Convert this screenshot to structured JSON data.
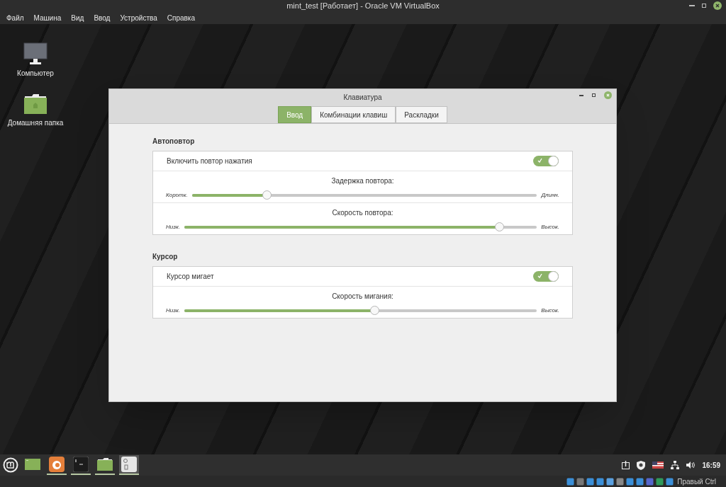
{
  "vbox": {
    "title": "mint_test [Работает] - Oracle VM VirtualBox",
    "menu": [
      "Файл",
      "Машина",
      "Вид",
      "Ввод",
      "Устройства",
      "Справка"
    ]
  },
  "desktop_icons": [
    {
      "kind": "computer",
      "label": "Компьютер"
    },
    {
      "kind": "folder",
      "label": "Домашняя папка"
    }
  ],
  "dialog": {
    "title": "Клавиатура",
    "tabs": [
      {
        "label": "Ввод",
        "selected": true
      },
      {
        "label": "Комбинации клавиш",
        "selected": false
      },
      {
        "label": "Раскладки",
        "selected": false
      }
    ],
    "sections": [
      {
        "heading": "Автоповтор",
        "rows": [
          {
            "kind": "switch",
            "label": "Включить повтор нажатия",
            "on": true
          },
          {
            "kind": "slider",
            "label": "Задержка повтора:",
            "min_label": "Коротк.",
            "max_label": "Длинн.",
            "level": 0.21
          },
          {
            "kind": "slider",
            "label": "Скорость повтора:",
            "min_label": "Низк.",
            "max_label": "Высок.",
            "level": 0.905
          }
        ]
      },
      {
        "heading": "Курсор",
        "rows": [
          {
            "kind": "switch",
            "label": "Курсор мигает",
            "on": true
          },
          {
            "kind": "slider",
            "label": "Скорость мигания:",
            "min_label": "Низк.",
            "max_label": "Высок.",
            "level": 0.54
          }
        ]
      }
    ]
  },
  "taskbar": {
    "apps": [
      {
        "kind": "files",
        "running": false,
        "selected": false
      },
      {
        "kind": "firefox",
        "running": true,
        "selected": false
      },
      {
        "kind": "terminal",
        "running": true,
        "selected": false
      },
      {
        "kind": "folder",
        "running": true,
        "selected": false
      },
      {
        "kind": "workspace",
        "running": true,
        "selected": true
      }
    ],
    "clock": "16:59"
  },
  "status_bar": {
    "host_key": "Правый Ctrl"
  }
}
